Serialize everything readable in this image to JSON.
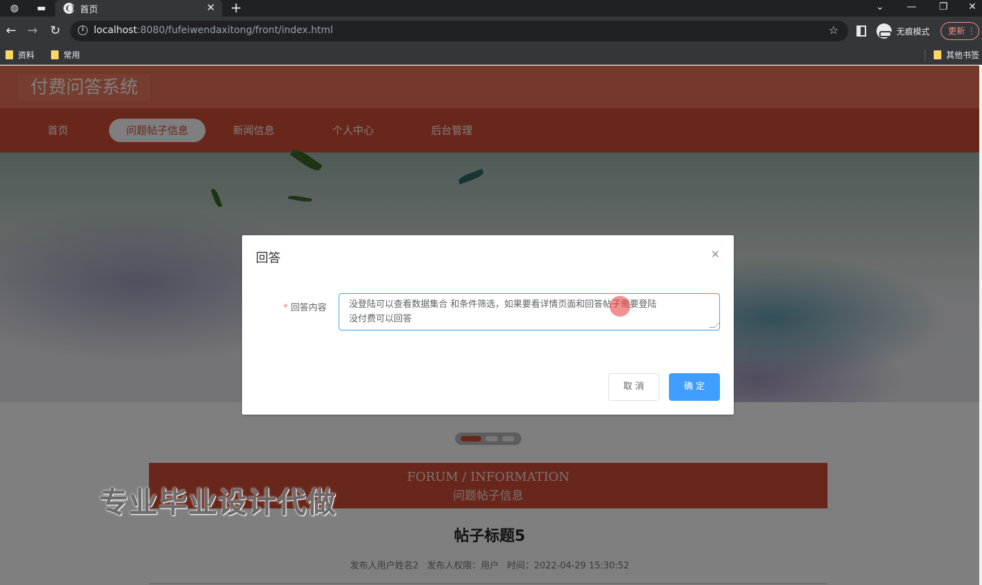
{
  "browser": {
    "tab_title": "首页",
    "url_host": "localhost",
    "url_rest": ":8080/fufeiwendaxitong/front/index.html",
    "incognito_label": "无痕模式",
    "update_label": "更新",
    "bookmarks": [
      "资料",
      "常用"
    ],
    "other_bookmarks": "其他书签"
  },
  "site": {
    "title": "付费问答系统",
    "nav": [
      "首页",
      "问题帖子信息",
      "新闻信息",
      "个人中心",
      "后台管理"
    ],
    "active_nav": "问题帖子信息"
  },
  "section": {
    "title_en": "FORUM / INFORMATION",
    "title_zh": "问题帖子信息"
  },
  "watermark": "专业毕业设计代做",
  "post": {
    "title": "帖子标题5",
    "author": "发布人用户姓名2",
    "role": "发布人权限：用户",
    "time": "时间：2022-04-29 15:30:52"
  },
  "dialog": {
    "title": "回答",
    "field_label": "回答内容",
    "field_value": "没登陆可以查看数据集合 和条件筛选，如果要看详情页面和回答帖子需要登陆\n没付费可以回答",
    "cancel_label": "取 消",
    "confirm_label": "确 定"
  }
}
